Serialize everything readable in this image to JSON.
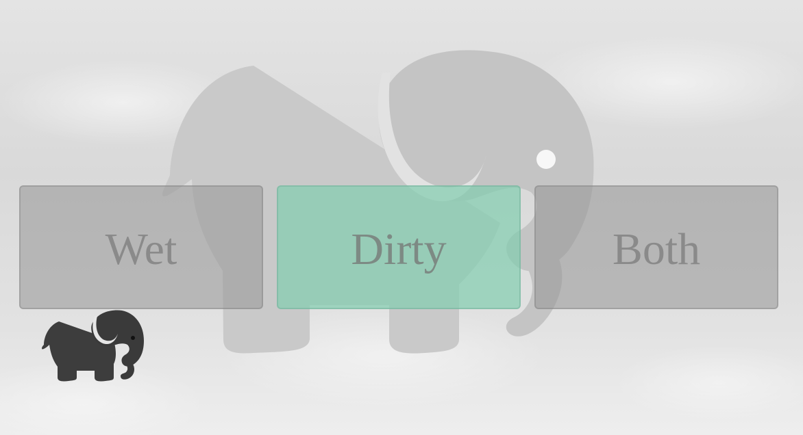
{
  "choices": {
    "wet_label": "Wet",
    "dirty_label": "Dirty",
    "both_label": "Both"
  },
  "colors": {
    "selected": "#9bcdb9",
    "unselected": "#a6a6a6",
    "label_text": "#8a8a8a",
    "elephant_background": "#c8c8c8",
    "elephant_logo": "#3c3c3c"
  },
  "icons": {
    "background": "elephant-icon",
    "logo": "elephant-icon"
  }
}
